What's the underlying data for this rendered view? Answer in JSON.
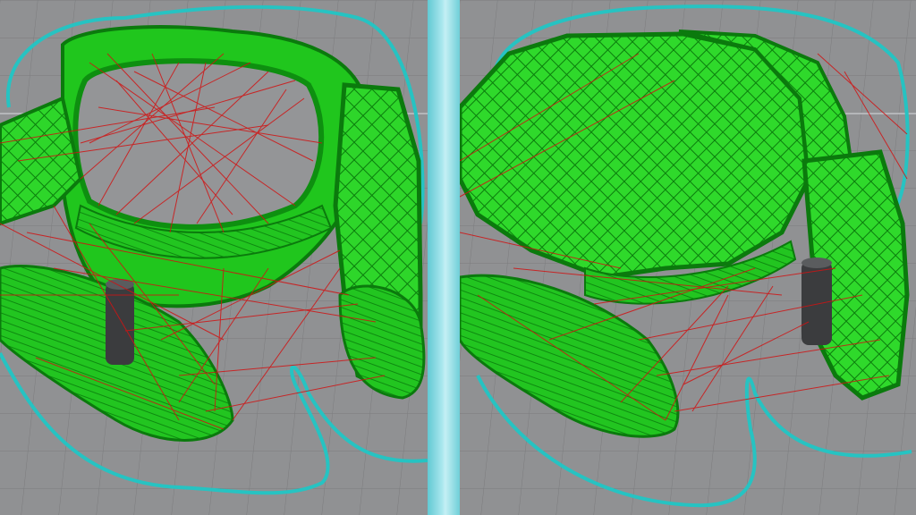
{
  "scene": {
    "background_color": "#8d8e90",
    "grid_color": "#7a7b7d",
    "grid_major_color": "#b9bbbe",
    "divider_color": "#8fdbe3",
    "colors": {
      "perimeter_green": "#19c51a",
      "infill_green": "#2fd92a",
      "edge_dark_green": "#0a7a0c",
      "travel_red": "#d11414",
      "skirt_cyan": "#23bfc0",
      "support_post": "#3a3b3d"
    }
  },
  "views": [
    {
      "id": "left",
      "description_icon": "toolpath-preview-icon",
      "layer_state": "lower"
    },
    {
      "id": "right",
      "description_icon": "toolpath-preview-icon",
      "layer_state": "upper"
    }
  ]
}
